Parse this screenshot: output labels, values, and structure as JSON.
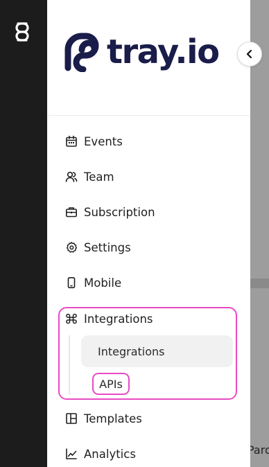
{
  "rail": {
    "logo_icon": "tray-s-logo-icon"
  },
  "brand": {
    "name": "tray.io",
    "color": "#1a1d4a"
  },
  "collapse": {
    "icon": "chevron-left-icon"
  },
  "nav": {
    "items": [
      {
        "label": "Events",
        "icon": "calendar-icon"
      },
      {
        "label": "Team",
        "icon": "users-icon"
      },
      {
        "label": "Subscription",
        "icon": "briefcase-icon"
      },
      {
        "label": "Settings",
        "icon": "gear-icon"
      },
      {
        "label": "Mobile",
        "icon": "mobile-icon"
      },
      {
        "label": "Integrations",
        "icon": "command-icon"
      },
      {
        "label": "Templates",
        "icon": "layout-icon"
      },
      {
        "label": "Analytics",
        "icon": "chart-line-icon"
      }
    ],
    "sub_items": [
      {
        "label": "Integrations",
        "active": true
      },
      {
        "label": "APIs",
        "active": false
      }
    ]
  },
  "highlight_color": "#e94ac3",
  "background_fragment": {
    "text": "Pardo"
  }
}
